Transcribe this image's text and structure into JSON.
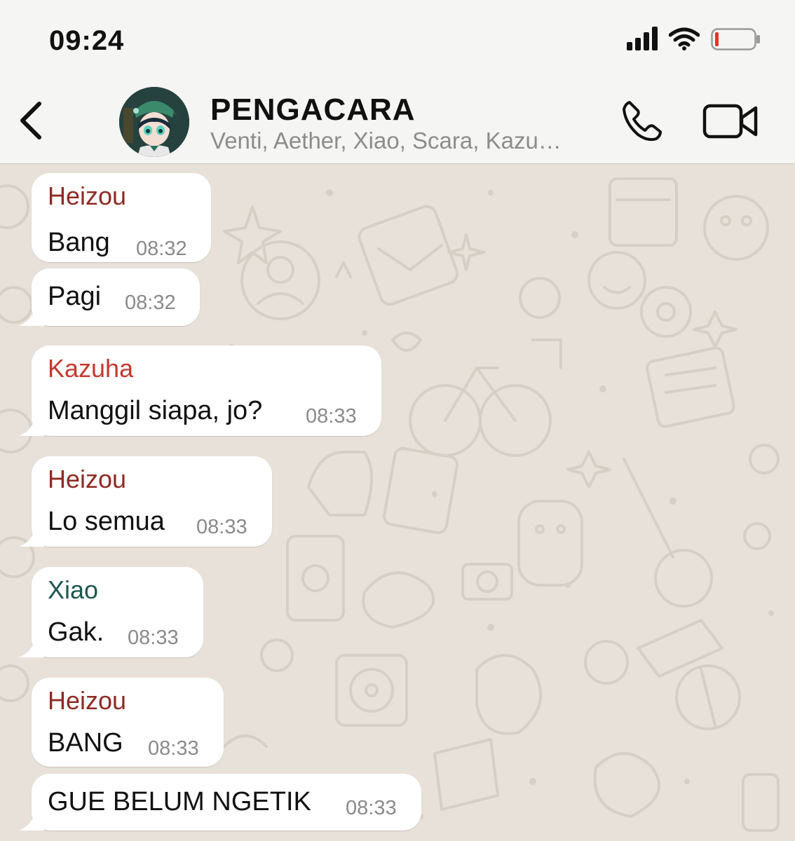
{
  "status_bar": {
    "time": "09:24"
  },
  "header": {
    "title": "PENGACARA",
    "subtitle": "Venti, Aether, Xiao, Scara, Kazu…",
    "back_icon": "chevron-left-icon",
    "call_icon": "phone-icon",
    "video_icon": "video-camera-icon"
  },
  "colors": {
    "heizou": "#8f2a24",
    "kazuha": "#c4392f",
    "xiao": "#1d5750",
    "bubble": "#ffffff",
    "wallpaper": "#e7e1d9"
  },
  "messages": [
    {
      "sender": "Heizou",
      "text": "Bang",
      "time": "08:32"
    },
    {
      "sender": "",
      "text": "Pagi",
      "time": "08:32"
    },
    {
      "sender": "Kazuha",
      "text": "Manggil siapa, jo?",
      "time": "08:33"
    },
    {
      "sender": "Heizou",
      "text": "Lo semua",
      "time": "08:33"
    },
    {
      "sender": "Xiao",
      "text": "Gak.",
      "time": "08:33"
    },
    {
      "sender": "Heizou",
      "text": "BANG",
      "time": "08:33"
    },
    {
      "sender": "",
      "text": "GUE BELUM NGETIK",
      "time": "08:33"
    }
  ]
}
